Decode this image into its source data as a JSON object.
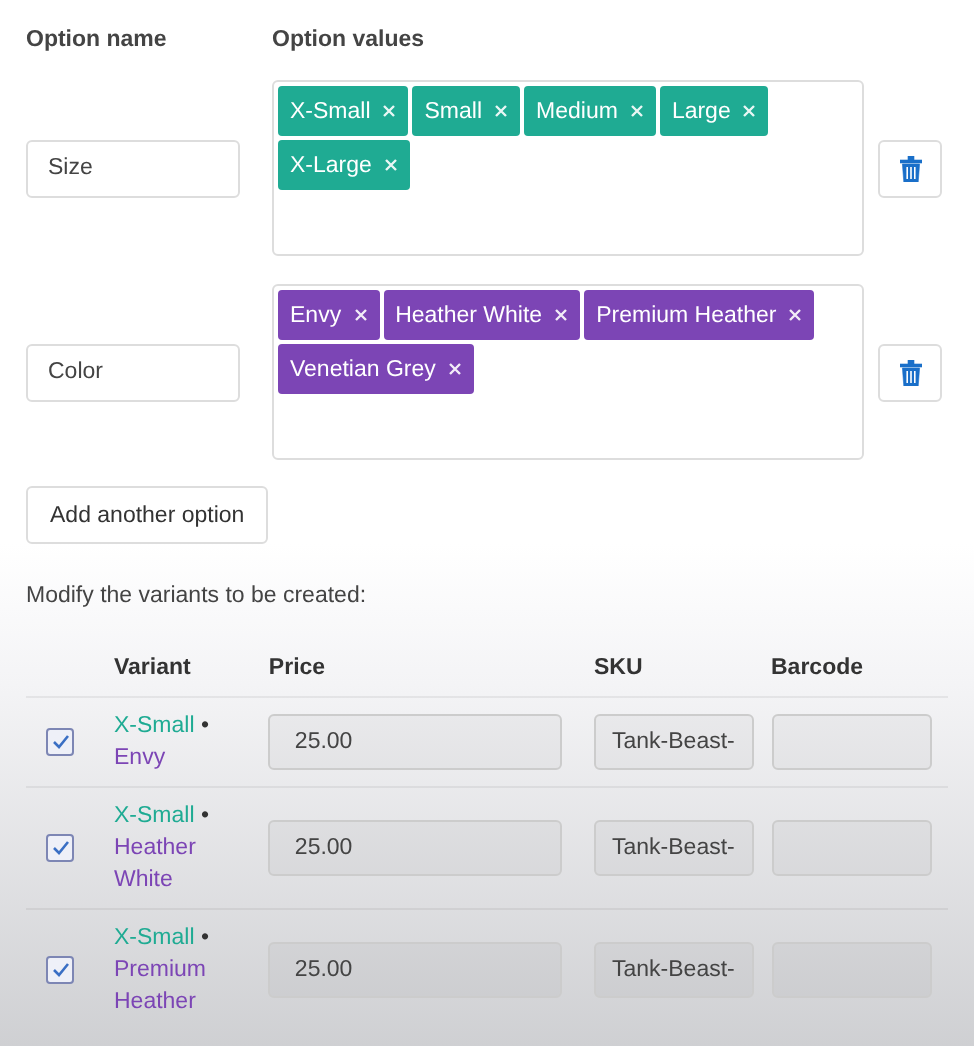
{
  "headers": {
    "name": "Option name",
    "values": "Option values"
  },
  "options": [
    {
      "name": "Size",
      "color": "#1fab93",
      "values": [
        "X-Small",
        "Small",
        "Medium",
        "Large",
        "X-Large"
      ]
    },
    {
      "name": "Color",
      "color": "#7c45b5",
      "values": [
        "Envy",
        "Heather White",
        "Premium Heather",
        "Venetian Grey"
      ]
    }
  ],
  "add_button": "Add another option",
  "variants_caption": "Modify the variants to be created:",
  "table": {
    "columns": [
      "Variant",
      "Price",
      "SKU",
      "Barcode"
    ],
    "rows": [
      {
        "checked": true,
        "size": "X-Small",
        "separator": "•",
        "color_value": "Envy",
        "price": "25.00",
        "sku": "Tank-Beast-"
      },
      {
        "checked": true,
        "size": "X-Small",
        "separator": "•",
        "color_value": "Heather White",
        "price": "25.00",
        "sku": "Tank-Beast-"
      },
      {
        "checked": true,
        "size": "X-Small",
        "separator": "•",
        "color_value": "Premium Heather",
        "price": "25.00",
        "sku": "Tank-Beast-"
      }
    ]
  }
}
